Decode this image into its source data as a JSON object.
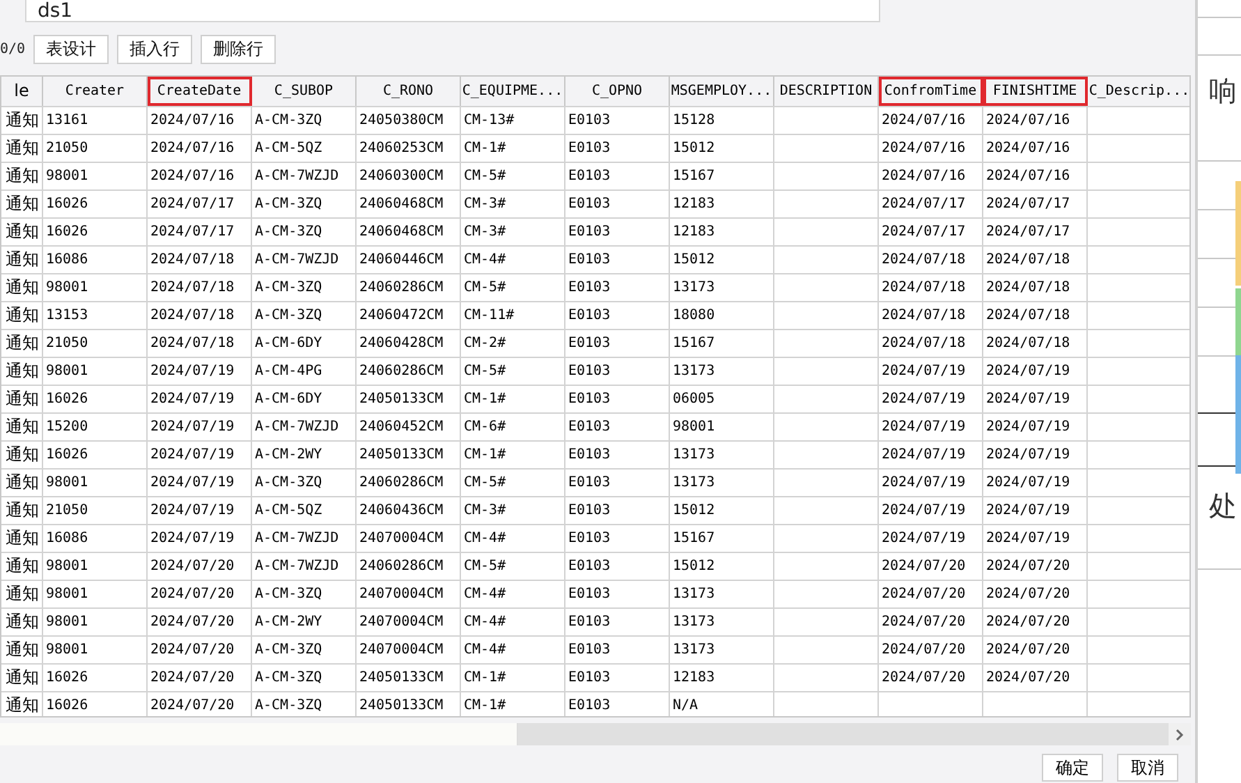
{
  "dataset_field": {
    "value": "ds1"
  },
  "toolbar": {
    "counter": "0/0",
    "buttons": [
      "表设计",
      "插入行",
      "删除行"
    ]
  },
  "table": {
    "columns": [
      {
        "label": "le",
        "highlighted": false
      },
      {
        "label": "Creater",
        "highlighted": false
      },
      {
        "label": "CreateDate",
        "highlighted": true
      },
      {
        "label": "C_SUBOP",
        "highlighted": false
      },
      {
        "label": "C_RONO",
        "highlighted": false
      },
      {
        "label": "C_EQUIPME...",
        "highlighted": false
      },
      {
        "label": "C_OPNO",
        "highlighted": false
      },
      {
        "label": "MSGEMPLOY...",
        "highlighted": false
      },
      {
        "label": "DESCRIPTION",
        "highlighted": false
      },
      {
        "label": "ConfromTime",
        "highlighted": true
      },
      {
        "label": "FINISHTIME",
        "highlighted": true
      },
      {
        "label": "C_Descrip...",
        "highlighted": false
      }
    ],
    "rows": [
      [
        "通知",
        "13161",
        "2024/07/16",
        "A-CM-3ZQ",
        "24050380CM",
        "CM-13#",
        "E0103",
        "15128",
        "",
        "2024/07/16",
        "2024/07/16",
        ""
      ],
      [
        "通知",
        "21050",
        "2024/07/16",
        "A-CM-5QZ",
        "24060253CM",
        "CM-1#",
        "E0103",
        "15012",
        "",
        "2024/07/16",
        "2024/07/16",
        ""
      ],
      [
        "通知",
        "98001",
        "2024/07/16",
        "A-CM-7WZJD",
        "24060300CM",
        "CM-5#",
        "E0103",
        "15167",
        "",
        "2024/07/16",
        "2024/07/16",
        ""
      ],
      [
        "通知",
        "16026",
        "2024/07/17",
        "A-CM-3ZQ",
        "24060468CM",
        "CM-3#",
        "E0103",
        "12183",
        "",
        "2024/07/17",
        "2024/07/17",
        ""
      ],
      [
        "通知",
        "16026",
        "2024/07/17",
        "A-CM-3ZQ",
        "24060468CM",
        "CM-3#",
        "E0103",
        "12183",
        "",
        "2024/07/17",
        "2024/07/17",
        ""
      ],
      [
        "通知",
        "16086",
        "2024/07/18",
        "A-CM-7WZJD",
        "24060446CM",
        "CM-4#",
        "E0103",
        "15012",
        "",
        "2024/07/18",
        "2024/07/18",
        ""
      ],
      [
        "通知",
        "98001",
        "2024/07/18",
        "A-CM-3ZQ",
        "24060286CM",
        "CM-5#",
        "E0103",
        "13173",
        "",
        "2024/07/18",
        "2024/07/18",
        ""
      ],
      [
        "通知",
        "13153",
        "2024/07/18",
        "A-CM-3ZQ",
        "24060472CM",
        "CM-11#",
        "E0103",
        "18080",
        "",
        "2024/07/18",
        "2024/07/18",
        ""
      ],
      [
        "通知",
        "21050",
        "2024/07/18",
        "A-CM-6DY",
        "24060428CM",
        "CM-2#",
        "E0103",
        "15167",
        "",
        "2024/07/18",
        "2024/07/18",
        ""
      ],
      [
        "通知",
        "98001",
        "2024/07/19",
        "A-CM-4PG",
        "24060286CM",
        "CM-5#",
        "E0103",
        "13173",
        "",
        "2024/07/19",
        "2024/07/19",
        ""
      ],
      [
        "通知",
        "16026",
        "2024/07/19",
        "A-CM-6DY",
        "24050133CM",
        "CM-1#",
        "E0103",
        "06005",
        "",
        "2024/07/19",
        "2024/07/19",
        ""
      ],
      [
        "通知",
        "15200",
        "2024/07/19",
        "A-CM-7WZJD",
        "24060452CM",
        "CM-6#",
        "E0103",
        "98001",
        "",
        "2024/07/19",
        "2024/07/19",
        ""
      ],
      [
        "通知",
        "16026",
        "2024/07/19",
        "A-CM-2WY",
        "24050133CM",
        "CM-1#",
        "E0103",
        "13173",
        "",
        "2024/07/19",
        "2024/07/19",
        ""
      ],
      [
        "通知",
        "98001",
        "2024/07/19",
        "A-CM-3ZQ",
        "24060286CM",
        "CM-5#",
        "E0103",
        "13173",
        "",
        "2024/07/19",
        "2024/07/19",
        ""
      ],
      [
        "通知",
        "21050",
        "2024/07/19",
        "A-CM-5QZ",
        "24060436CM",
        "CM-3#",
        "E0103",
        "15012",
        "",
        "2024/07/19",
        "2024/07/19",
        ""
      ],
      [
        "通知",
        "16086",
        "2024/07/19",
        "A-CM-7WZJD",
        "24070004CM",
        "CM-4#",
        "E0103",
        "15167",
        "",
        "2024/07/19",
        "2024/07/19",
        ""
      ],
      [
        "通知",
        "98001",
        "2024/07/20",
        "A-CM-7WZJD",
        "24060286CM",
        "CM-5#",
        "E0103",
        "15012",
        "",
        "2024/07/20",
        "2024/07/20",
        ""
      ],
      [
        "通知",
        "98001",
        "2024/07/20",
        "A-CM-3ZQ",
        "24070004CM",
        "CM-4#",
        "E0103",
        "13173",
        "",
        "2024/07/20",
        "2024/07/20",
        ""
      ],
      [
        "通知",
        "98001",
        "2024/07/20",
        "A-CM-2WY",
        "24070004CM",
        "CM-4#",
        "E0103",
        "13173",
        "",
        "2024/07/20",
        "2024/07/20",
        ""
      ],
      [
        "通知",
        "98001",
        "2024/07/20",
        "A-CM-3ZQ",
        "24070004CM",
        "CM-4#",
        "E0103",
        "13173",
        "",
        "2024/07/20",
        "2024/07/20",
        ""
      ],
      [
        "通知",
        "16026",
        "2024/07/20",
        "A-CM-3ZQ",
        "24050133CM",
        "CM-1#",
        "E0103",
        "12183",
        "",
        "2024/07/20",
        "2024/07/20",
        ""
      ],
      [
        "通知",
        "16026",
        "2024/07/20",
        "A-CM-3ZQ",
        "24050133CM",
        "CM-1#",
        "E0103",
        "N/A",
        "",
        "",
        "",
        ""
      ]
    ]
  },
  "footer": {
    "buttons": [
      "确定",
      "取消"
    ]
  },
  "side_panel": {
    "texts": [
      "响",
      "处"
    ]
  }
}
